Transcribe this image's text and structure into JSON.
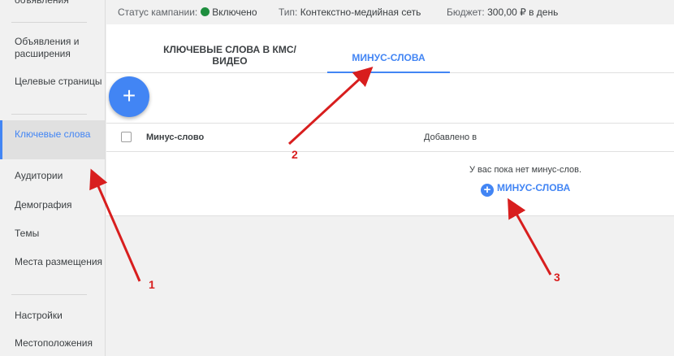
{
  "sidebar": {
    "items": [
      {
        "label": "объявления"
      },
      {
        "label": "Объявления и расширения"
      },
      {
        "label": "Целевые страницы"
      },
      {
        "label": "Ключевые слова"
      },
      {
        "label": "Аудитории"
      },
      {
        "label": "Демография"
      },
      {
        "label": "Темы"
      },
      {
        "label": "Места размещения"
      },
      {
        "label": "Настройки"
      },
      {
        "label": "Местоположения"
      }
    ]
  },
  "status": {
    "campaign_label": "Статус кампании:",
    "campaign_value": "Включено",
    "type_label": "Тип:",
    "type_value": "Контекстно-медийная сеть",
    "budget_label": "Бюджет:",
    "budget_value": "300,00 ₽ в день"
  },
  "tabs": [
    {
      "label": "КЛЮЧЕВЫЕ СЛОВА В КМС/ ВИДЕО"
    },
    {
      "label": "МИНУС-СЛОВА"
    }
  ],
  "fab": {
    "label": "+"
  },
  "table": {
    "columns": [
      "Минус-слово",
      "Добавлено в"
    ]
  },
  "empty": {
    "message": "У вас пока нет минус-слов.",
    "button_label": "МИНУС-СЛОВА",
    "button_icon": "+"
  },
  "annotations": {
    "labels": [
      "1",
      "2",
      "3"
    ],
    "color": "#d81e1e"
  },
  "colors": {
    "accent": "#4285f4",
    "status_green": "#1e8e3e"
  }
}
